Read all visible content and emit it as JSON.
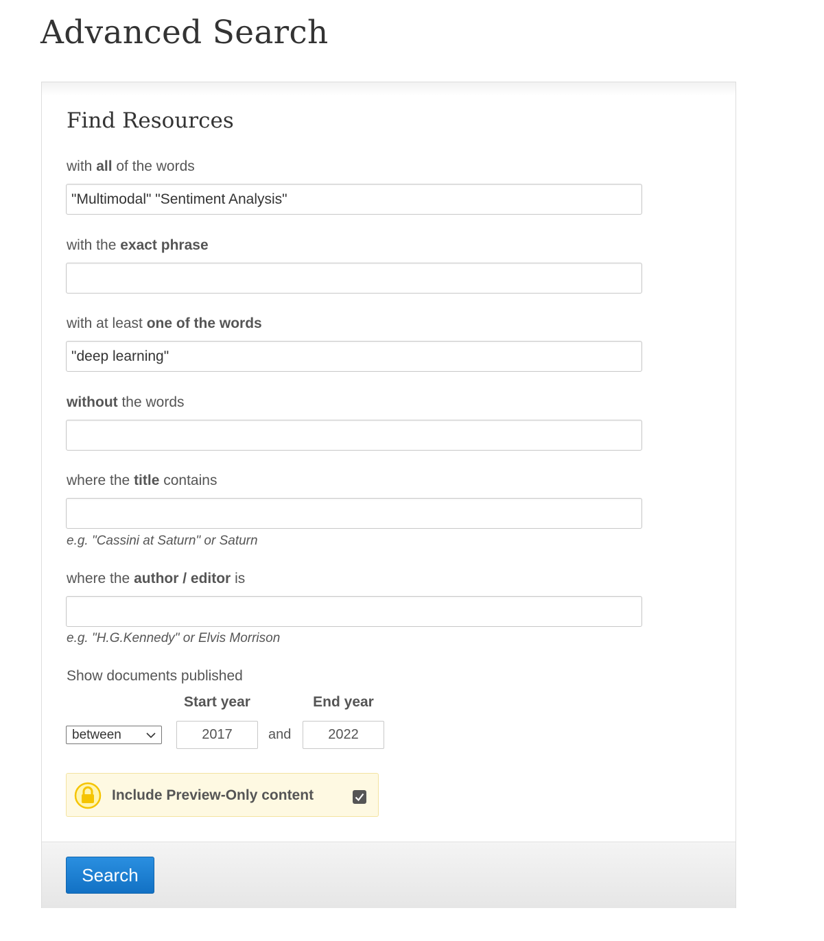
{
  "page_title": "Advanced Search",
  "panel": {
    "heading": "Find Resources",
    "fields": {
      "all_words": {
        "label_pre": "with ",
        "label_bold": "all",
        "label_post": " of the words",
        "value": "\"Multimodal\" \"Sentiment Analysis\""
      },
      "exact_phrase": {
        "label_pre": "with the ",
        "label_bold": "exact phrase",
        "label_post": "",
        "value": ""
      },
      "one_of_words": {
        "label_pre": "with at least ",
        "label_bold": "one of the words",
        "label_post": "",
        "value": "\"deep learning\""
      },
      "without_words": {
        "label_pre": "",
        "label_bold": "without",
        "label_post": " the words",
        "value": ""
      },
      "title": {
        "label_pre": "where the ",
        "label_bold": "title",
        "label_post": " contains",
        "value": "",
        "hint": "e.g. \"Cassini at Saturn\" or Saturn"
      },
      "author": {
        "label_pre": "where the ",
        "label_bold": "author / editor",
        "label_post": " is",
        "value": "",
        "hint": "e.g. \"H.G.Kennedy\" or Elvis Morrison"
      }
    },
    "published": {
      "label": "Show documents published",
      "start_label": "Start year",
      "end_label": "End year",
      "range_select": "between",
      "and_text": "and",
      "start_year": "2017",
      "end_year": "2022"
    },
    "preview": {
      "label": "Include Preview-Only content",
      "checked": true,
      "icon": "lock-icon"
    },
    "search_button": "Search"
  },
  "colors": {
    "button": "#1a7fd4",
    "preview_bg": "#fef9e2",
    "lock": "#f5c400"
  }
}
